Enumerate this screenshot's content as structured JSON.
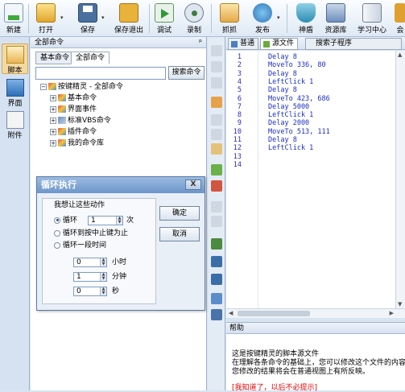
{
  "toolbar": {
    "new": "新建",
    "open": "打开",
    "save": "保存",
    "save_exit": "保存退出",
    "debug": "调试",
    "record": "录制",
    "capture": "抓抓",
    "publish": "发布",
    "shield": "神盾",
    "library": "资源库",
    "learn": "学习中心",
    "more": "会"
  },
  "left_tabs": {
    "script": "脚本",
    "ui": "界面",
    "attach": "附件"
  },
  "command_panel": {
    "title": "全部命令",
    "pin": "ᵖ",
    "tabs": [
      "基本命令",
      "全部命令"
    ],
    "search_value": "",
    "search_button": "搜索命令",
    "tree": {
      "root": "按键精灵 - 全部命令",
      "items": [
        "基本命令",
        "界面事件",
        "标准VBS命令",
        "插件命令",
        "我的命令库"
      ]
    }
  },
  "editor": {
    "tabs": [
      "普通",
      "源文件",
      "搜索子程序"
    ],
    "lines": [
      {
        "n": "1",
        "code": "Delay 8"
      },
      {
        "n": "2",
        "code": "MoveTo 336, 80"
      },
      {
        "n": "3",
        "code": "Delay 8"
      },
      {
        "n": "4",
        "code": "LeftClick 1"
      },
      {
        "n": "5",
        "code": "Delay 8"
      },
      {
        "n": "6",
        "code": "MoveTo 423, 686"
      },
      {
        "n": "7",
        "code": "Delay 5000"
      },
      {
        "n": "8",
        "code": "LeftClick 1"
      },
      {
        "n": "9",
        "code": "Delay 2000"
      },
      {
        "n": "10",
        "code": "MoveTo 513, 111"
      },
      {
        "n": "11",
        "code": "Delay 8"
      },
      {
        "n": "12",
        "code": "LeftClick 1"
      },
      {
        "n": "13",
        "code": ""
      },
      {
        "n": "14",
        "code": ""
      }
    ]
  },
  "help": {
    "title": "帮助",
    "line1": "这是按键精灵的脚本源文件",
    "line2": "在理解各条命令的基础上，您可以修改这个文件的内容",
    "line3": "您修改的结果将会在普通视图上有所反映。",
    "link": "[我知道了，以后不必提示]"
  },
  "dialog": {
    "title": "循环执行",
    "close": "X",
    "question": "我想让这些动作",
    "option_loop": "循环",
    "loop_count": "1",
    "loop_unit": "次",
    "option_until_stop": "循环到按中止键为止",
    "option_duration": "循环一段时间",
    "hours_value": "0",
    "hours_unit": "小时",
    "minutes_value": "1",
    "minutes_unit": "分钟",
    "seconds_value": "0",
    "seconds_unit": "秒",
    "ok": "确定",
    "cancel": "取消"
  },
  "colors": {
    "accent": "#6d95c8",
    "code_blue": "#1b2ec4",
    "link_red": "#e00000"
  }
}
